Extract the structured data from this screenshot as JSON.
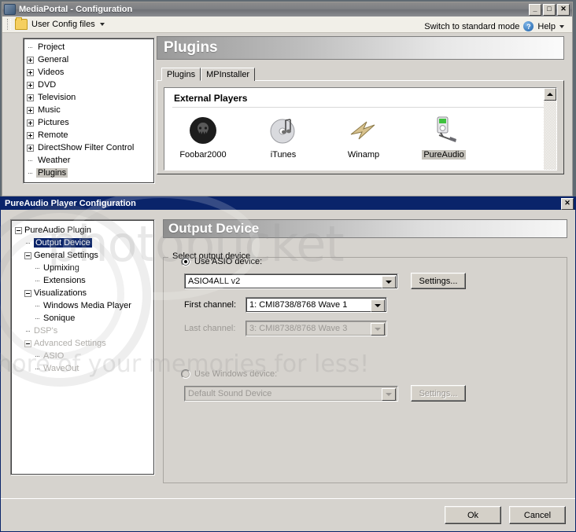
{
  "main_window": {
    "title": "MediaPortal - Configuration",
    "window_buttons": {
      "minimize": "_",
      "maximize": "□",
      "close": "✕"
    },
    "toolbar": {
      "config_files_label": "User Config files",
      "dropdown_caret": "▾"
    },
    "top_right": {
      "switch_mode_label": "Switch to standard mode",
      "help_label": "Help",
      "help_glyph": "?",
      "help_caret": "▾"
    },
    "tree": {
      "items": [
        {
          "label": "Project",
          "expandable": false
        },
        {
          "label": "General",
          "expandable": true
        },
        {
          "label": "Videos",
          "expandable": true
        },
        {
          "label": "DVD",
          "expandable": true
        },
        {
          "label": "Television",
          "expandable": true
        },
        {
          "label": "Music",
          "expandable": true
        },
        {
          "label": "Pictures",
          "expandable": true
        },
        {
          "label": "Remote",
          "expandable": true
        },
        {
          "label": "DirectShow Filter Control",
          "expandable": true
        },
        {
          "label": "Weather",
          "expandable": false
        },
        {
          "label": "Plugins",
          "expandable": false,
          "selected": true
        }
      ]
    },
    "page_header": "Plugins",
    "tabs": [
      {
        "label": "Plugins",
        "active": true
      },
      {
        "label": "MPInstaller",
        "active": false
      }
    ],
    "players_group": {
      "title": "External Players"
    },
    "players": [
      {
        "label": "Foobar2000",
        "icon": "foobar2000-icon",
        "selected": false
      },
      {
        "label": "iTunes",
        "icon": "itunes-icon",
        "selected": false
      },
      {
        "label": "Winamp",
        "icon": "winamp-icon",
        "selected": false
      },
      {
        "label": "PureAudio",
        "icon": "pureaudio-icon",
        "selected": true
      }
    ]
  },
  "dialog": {
    "title": "PureAudio Player Configuration",
    "close_glyph": "✕",
    "tree": {
      "items": [
        {
          "label": "PureAudio Plugin",
          "level": 0,
          "expander": "minus",
          "state": "normal"
        },
        {
          "label": "Output Device",
          "level": 1,
          "expander": "leaf",
          "state": "selected"
        },
        {
          "label": "General Settings",
          "level": 1,
          "expander": "minus",
          "state": "normal"
        },
        {
          "label": "Upmixing",
          "level": 2,
          "expander": "leaf",
          "state": "normal"
        },
        {
          "label": "Extensions",
          "level": 2,
          "expander": "leaf",
          "state": "normal"
        },
        {
          "label": "Visualizations",
          "level": 1,
          "expander": "minus",
          "state": "normal"
        },
        {
          "label": "Windows Media Player",
          "level": 2,
          "expander": "leaf",
          "state": "normal"
        },
        {
          "label": "Sonique",
          "level": 2,
          "expander": "leaf",
          "state": "normal"
        },
        {
          "label": "DSP's",
          "level": 1,
          "expander": "leaf",
          "state": "disabled"
        },
        {
          "label": "Advanced Settings",
          "level": 1,
          "expander": "minus",
          "state": "disabled"
        },
        {
          "label": "ASIO",
          "level": 2,
          "expander": "leaf",
          "state": "disabled"
        },
        {
          "label": "WaveOut",
          "level": 2,
          "expander": "leaf",
          "state": "disabled"
        }
      ]
    },
    "page_header": "Output Device",
    "group_legend": "Select output device",
    "asio": {
      "radio_label": "Use ASIO device:",
      "radio_selected": true,
      "device_value": "ASIO4ALL v2",
      "settings_button": "Settings...",
      "first_channel_label": "First channel:",
      "first_channel_value": "1: CMI8738/8768 Wave 1",
      "last_channel_label": "Last channel:",
      "last_channel_value": "3: CMI8738/8768 Wave 3",
      "last_channel_disabled": true
    },
    "windows_device": {
      "radio_label": "Use Windows device:",
      "radio_selected": false,
      "disabled": true,
      "device_value": "Default Sound Device",
      "settings_button": "Settings..."
    },
    "footer": {
      "ok_label": "Ok",
      "cancel_label": "Cancel"
    }
  },
  "watermark": {
    "brand": "photobucket",
    "tagline": "more of your memories for less!"
  },
  "colors": {
    "dialog_titlebar": "#0a246a",
    "selection": "#0a246a",
    "window_face": "#d6d3ce",
    "desktop": "#5f6a72",
    "disabled_text": "#9b9894"
  }
}
